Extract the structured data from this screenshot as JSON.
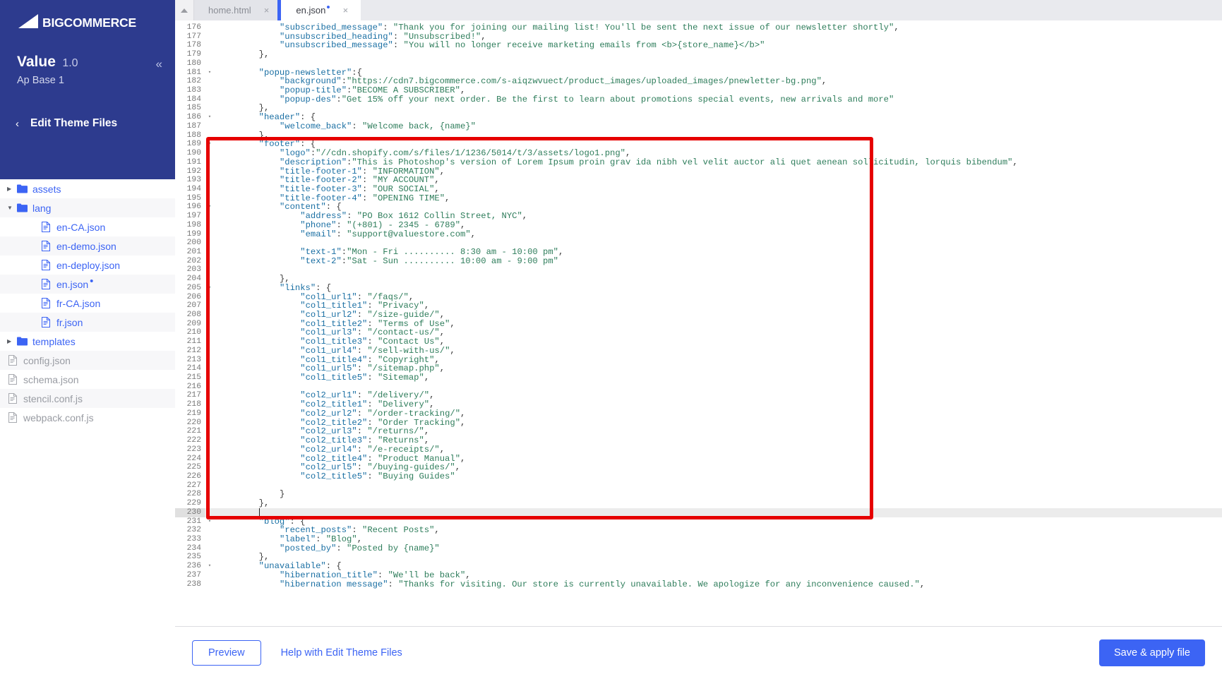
{
  "brand": {
    "logo_text": "BIGCOMMERCE",
    "logo_icon": "bigcommerce-logo-icon"
  },
  "sidebar": {
    "theme_name": "Value",
    "theme_version": "1.0",
    "theme_variant": "Ap Base 1",
    "collapse_icon": "«",
    "back_icon": "‹",
    "section_title": "Edit Theme Files",
    "tree": [
      {
        "label": "assets",
        "type": "folder",
        "depth": 0,
        "expanded": false,
        "dirty": false,
        "disabled": false
      },
      {
        "label": "lang",
        "type": "folder",
        "depth": 0,
        "expanded": true,
        "dirty": false,
        "disabled": false
      },
      {
        "label": "en-CA.json",
        "type": "file",
        "depth": 1,
        "expanded": null,
        "dirty": false,
        "disabled": false
      },
      {
        "label": "en-demo.json",
        "type": "file",
        "depth": 1,
        "expanded": null,
        "dirty": false,
        "disabled": false
      },
      {
        "label": "en-deploy.json",
        "type": "file",
        "depth": 1,
        "expanded": null,
        "dirty": false,
        "disabled": false
      },
      {
        "label": "en.json",
        "type": "file",
        "depth": 1,
        "expanded": null,
        "dirty": true,
        "disabled": false
      },
      {
        "label": "fr-CA.json",
        "type": "file",
        "depth": 1,
        "expanded": null,
        "dirty": false,
        "disabled": false
      },
      {
        "label": "fr.json",
        "type": "file",
        "depth": 1,
        "expanded": null,
        "dirty": false,
        "disabled": false
      },
      {
        "label": "templates",
        "type": "folder",
        "depth": 0,
        "expanded": false,
        "dirty": false,
        "disabled": false
      },
      {
        "label": "config.json",
        "type": "file",
        "depth": -1,
        "expanded": null,
        "dirty": false,
        "disabled": true
      },
      {
        "label": "schema.json",
        "type": "file",
        "depth": -1,
        "expanded": null,
        "dirty": false,
        "disabled": true
      },
      {
        "label": "stencil.conf.js",
        "type": "file",
        "depth": -1,
        "expanded": null,
        "dirty": false,
        "disabled": true
      },
      {
        "label": "webpack.conf.js",
        "type": "file",
        "depth": -1,
        "expanded": null,
        "dirty": false,
        "disabled": true
      }
    ]
  },
  "tabs": [
    {
      "label": "home.html",
      "active": false,
      "dirty": false,
      "close_icon": "×"
    },
    {
      "label": "en.json",
      "active": true,
      "dirty": true,
      "close_icon": "×"
    }
  ],
  "editor": {
    "first_visible_line": 176,
    "active_line": 230,
    "lines": [
      {
        "n": 176,
        "fold": "",
        "text": "            \"subscribed_message\": \"Thank you for joining our mailing list! You'll be sent the next issue of our newsletter shortly\","
      },
      {
        "n": 177,
        "fold": "",
        "text": "            \"unsubscribed_heading\": \"Unsubscribed!\","
      },
      {
        "n": 178,
        "fold": "",
        "text": "            \"unsubscribed_message\": \"You will no longer receive marketing emails from <b>{store_name}</b>\""
      },
      {
        "n": 179,
        "fold": "",
        "text": "        },"
      },
      {
        "n": 180,
        "fold": "",
        "text": ""
      },
      {
        "n": 181,
        "fold": "▾",
        "text": "        \"popup-newsletter\":{"
      },
      {
        "n": 182,
        "fold": "",
        "text": "            \"background\":\"https://cdn7.bigcommerce.com/s-aiqzwvuect/product_images/uploaded_images/pnewletter-bg.png\","
      },
      {
        "n": 183,
        "fold": "",
        "text": "            \"popup-title\":\"BECOME A SUBSCRIBER\","
      },
      {
        "n": 184,
        "fold": "",
        "text": "            \"popup-des\":\"Get 15% off your next order. Be the first to learn about promotions special events, new arrivals and more\""
      },
      {
        "n": 185,
        "fold": "",
        "text": "        },"
      },
      {
        "n": 186,
        "fold": "▾",
        "text": "        \"header\": {"
      },
      {
        "n": 187,
        "fold": "",
        "text": "            \"welcome_back\": \"Welcome back, {name}\""
      },
      {
        "n": 188,
        "fold": "",
        "text": "        },"
      },
      {
        "n": 189,
        "fold": "▾",
        "text": "        \"footer\": {"
      },
      {
        "n": 190,
        "fold": "",
        "text": "            \"logo\":\"//cdn.shopify.com/s/files/1/1236/5014/t/3/assets/logo1.png\","
      },
      {
        "n": 191,
        "fold": "",
        "text": "            \"description\":\"This is Photoshop's version of Lorem Ipsum proin grav ida nibh vel velit auctor ali quet aenean sollicitudin, lorquis bibendum\","
      },
      {
        "n": 192,
        "fold": "",
        "text": "            \"title-footer-1\": \"INFORMATION\","
      },
      {
        "n": 193,
        "fold": "",
        "text": "            \"title-footer-2\": \"MY ACCOUNT\","
      },
      {
        "n": 194,
        "fold": "",
        "text": "            \"title-footer-3\": \"OUR SOCIAL\","
      },
      {
        "n": 195,
        "fold": "",
        "text": "            \"title-footer-4\": \"OPENING TIME\","
      },
      {
        "n": 196,
        "fold": "▾",
        "text": "            \"content\": {"
      },
      {
        "n": 197,
        "fold": "",
        "text": "                \"address\": \"PO Box 1612 Collin Street, NYC\","
      },
      {
        "n": 198,
        "fold": "",
        "text": "                \"phone\": \"(+801) - 2345 - 6789\","
      },
      {
        "n": 199,
        "fold": "",
        "text": "                \"email\": \"support@valuestore.com\","
      },
      {
        "n": 200,
        "fold": "",
        "text": ""
      },
      {
        "n": 201,
        "fold": "",
        "text": "                \"text-1\":\"Mon - Fri .......... 8:30 am - 10:00 pm\","
      },
      {
        "n": 202,
        "fold": "",
        "text": "                \"text-2\":\"Sat - Sun .......... 10:00 am - 9:00 pm\""
      },
      {
        "n": 203,
        "fold": "",
        "text": ""
      },
      {
        "n": 204,
        "fold": "",
        "text": "            },"
      },
      {
        "n": 205,
        "fold": "▾",
        "text": "            \"links\": {"
      },
      {
        "n": 206,
        "fold": "",
        "text": "                \"col1_url1\": \"/faqs/\","
      },
      {
        "n": 207,
        "fold": "",
        "text": "                \"col1_title1\": \"Privacy\","
      },
      {
        "n": 208,
        "fold": "",
        "text": "                \"col1_url2\": \"/size-guide/\","
      },
      {
        "n": 209,
        "fold": "",
        "text": "                \"col1_title2\": \"Terms of Use\","
      },
      {
        "n": 210,
        "fold": "",
        "text": "                \"col1_url3\": \"/contact-us/\","
      },
      {
        "n": 211,
        "fold": "",
        "text": "                \"col1_title3\": \"Contact Us\","
      },
      {
        "n": 212,
        "fold": "",
        "text": "                \"col1_url4\": \"/sell-with-us/\","
      },
      {
        "n": 213,
        "fold": "",
        "text": "                \"col1_title4\": \"Copyright\","
      },
      {
        "n": 214,
        "fold": "",
        "text": "                \"col1_url5\": \"/sitemap.php\","
      },
      {
        "n": 215,
        "fold": "",
        "text": "                \"col1_title5\": \"Sitemap\","
      },
      {
        "n": 216,
        "fold": "",
        "text": ""
      },
      {
        "n": 217,
        "fold": "",
        "text": "                \"col2_url1\": \"/delivery/\","
      },
      {
        "n": 218,
        "fold": "",
        "text": "                \"col2_title1\": \"Delivery\","
      },
      {
        "n": 219,
        "fold": "",
        "text": "                \"col2_url2\": \"/order-tracking/\","
      },
      {
        "n": 220,
        "fold": "",
        "text": "                \"col2_title2\": \"Order Tracking\","
      },
      {
        "n": 221,
        "fold": "",
        "text": "                \"col2_url3\": \"/returns/\","
      },
      {
        "n": 222,
        "fold": "",
        "text": "                \"col2_title3\": \"Returns\","
      },
      {
        "n": 223,
        "fold": "",
        "text": "                \"col2_url4\": \"/e-receipts/\","
      },
      {
        "n": 224,
        "fold": "",
        "text": "                \"col2_title4\": \"Product Manual\","
      },
      {
        "n": 225,
        "fold": "",
        "text": "                \"col2_url5\": \"/buying-guides/\","
      },
      {
        "n": 226,
        "fold": "",
        "text": "                \"col2_title5\": \"Buying Guides\""
      },
      {
        "n": 227,
        "fold": "",
        "text": ""
      },
      {
        "n": 228,
        "fold": "",
        "text": "            }"
      },
      {
        "n": 229,
        "fold": "",
        "text": "        },"
      },
      {
        "n": 230,
        "fold": "",
        "text": ""
      },
      {
        "n": 231,
        "fold": "▾",
        "text": "        \"blog\": {"
      },
      {
        "n": 232,
        "fold": "",
        "text": "            \"recent_posts\": \"Recent Posts\","
      },
      {
        "n": 233,
        "fold": "",
        "text": "            \"label\": \"Blog\","
      },
      {
        "n": 234,
        "fold": "",
        "text": "            \"posted_by\": \"Posted by {name}\""
      },
      {
        "n": 235,
        "fold": "",
        "text": "        },"
      },
      {
        "n": 236,
        "fold": "▾",
        "text": "        \"unavailable\": {"
      },
      {
        "n": 237,
        "fold": "",
        "text": "            \"hibernation_title\": \"We'll be back\","
      },
      {
        "n": 238,
        "fold": "",
        "text": "            \"hibernation message\": \"Thanks for visiting. Our store is currently unavailable. We apologize for any inconvenience caused.\","
      }
    ]
  },
  "annotation": {
    "shape": "rectangle",
    "color": "#e60000",
    "target": "footer-json-block"
  },
  "footerbar": {
    "preview_label": "Preview",
    "help_label": "Help with Edit Theme Files",
    "save_label": "Save & apply file"
  },
  "colors": {
    "brand_navy": "#2d3b8e",
    "accent_blue": "#3c64f4",
    "annotation_red": "#e60000",
    "code_string": "#2e7d5b",
    "code_key": "#1a6fa3"
  }
}
